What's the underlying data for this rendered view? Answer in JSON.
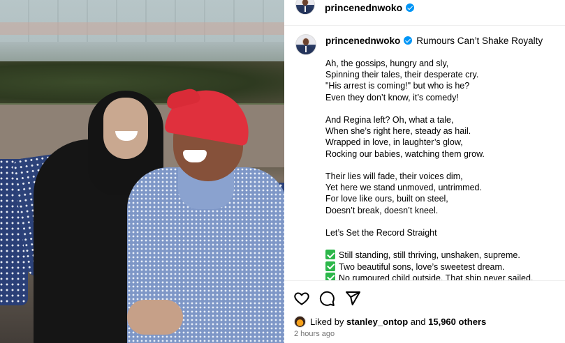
{
  "header": {
    "username": "princenednwoko"
  },
  "post": {
    "username": "princenednwoko",
    "title": "Rumours Can’t Shake Royalty",
    "stanzas": [
      [
        "Ah, the gossips, hungry and sly,",
        "Spinning their tales, their desperate cry.",
        "\"His arrest is coming!\" but who is he?",
        "Even they don’t know, it’s comedy!"
      ],
      [
        "And Regina left? Oh, what a tale,",
        "When she’s right here, steady as hail.",
        "Wrapped in love, in laughter’s glow,",
        "Rocking our babies, watching them grow."
      ],
      [
        "Their lies will fade, their voices dim,",
        "Yet here we stand unmoved, untrimmed.",
        "For love like ours, built on steel,",
        "Doesn’t break, doesn’t kneel."
      ],
      [
        "Let’s Set the Record Straight"
      ]
    ],
    "checklist": [
      "Still standing, still thriving, unshaken, supreme.",
      "Two beautiful sons, love’s sweetest dream.",
      "No rumoured child outside, That ship never sailed,"
    ],
    "checklist_icon": "check-mark-button-emoji"
  },
  "actions": {
    "icons": [
      "heart-icon",
      "comment-icon",
      "share-icon"
    ]
  },
  "likes": {
    "prefix": "Liked by",
    "user": "stanley_ontop",
    "and": "and",
    "count": "15,960 others"
  },
  "timestamp": "2 hours ago",
  "colors": {
    "verified": "#0095f6",
    "muted_text": "#737373",
    "check_green": "#2cb74a",
    "cap_red": "#e0303d"
  }
}
